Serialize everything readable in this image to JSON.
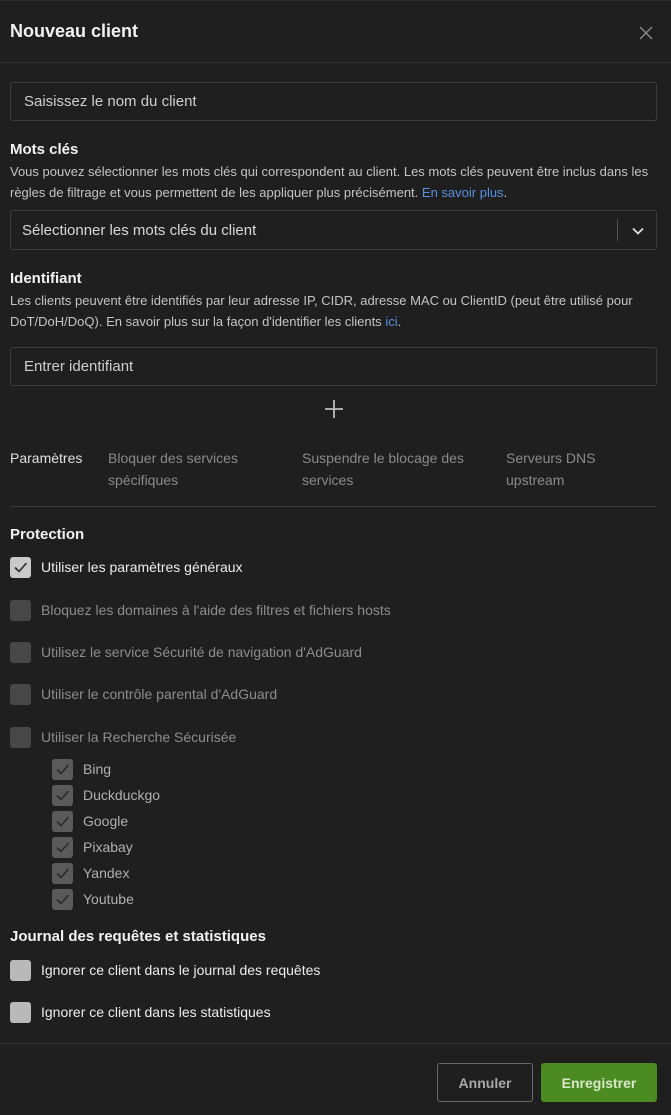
{
  "dialog": {
    "title": "Nouveau client",
    "close_icon": "close-icon"
  },
  "name_input": {
    "placeholder": "Saisissez le nom du client",
    "value": ""
  },
  "tags": {
    "title": "Mots clés",
    "description": "Vous pouvez sélectionner les mots clés qui correspondent au client. Les mots clés peuvent être inclus dans les règles de filtrage et vous permettent de les appliquer plus précisément.",
    "link_text": "En savoir plus",
    "link_suffix": ".",
    "select_placeholder": "Sélectionner les mots clés du client",
    "chevron_icon": "chevron-down-icon"
  },
  "identifier": {
    "title": "Identifiant",
    "description": "Les clients peuvent être identifiés par leur adresse IP, CIDR, adresse MAC ou ClientID (peut être utilisé pour DoT/DoH/DoQ). En savoir plus sur la façon d'identifier les clients",
    "link_text": "ici",
    "link_suffix": ".",
    "input_placeholder": "Entrer identifiant",
    "add_icon": "plus-icon"
  },
  "tabs": [
    {
      "label": "Paramètres",
      "active": true
    },
    {
      "label": "Bloquer des services spécifiques",
      "active": false
    },
    {
      "label": "Suspendre le blocage des services",
      "active": false
    },
    {
      "label": "Serveurs DNS upstream",
      "active": false
    }
  ],
  "protection": {
    "title": "Protection",
    "options": [
      {
        "label": "Utiliser les paramètres généraux",
        "checked": true
      },
      {
        "label": "Bloquez les domaines à l'aide des filtres et fichiers hosts",
        "checked": false
      },
      {
        "label": "Utilisez le service Sécurité de navigation d'AdGuard",
        "checked": false
      },
      {
        "label": "Utiliser le contrôle parental d'AdGuard",
        "checked": false
      },
      {
        "label": "Utiliser la Recherche Sécurisée",
        "checked": false
      }
    ],
    "safe_search_engines": [
      {
        "label": "Bing",
        "checked": true
      },
      {
        "label": "Duckduckgo",
        "checked": true
      },
      {
        "label": "Google",
        "checked": true
      },
      {
        "label": "Pixabay",
        "checked": true
      },
      {
        "label": "Yandex",
        "checked": true
      },
      {
        "label": "Youtube",
        "checked": true
      }
    ]
  },
  "logs": {
    "title": "Journal des requêtes et statistiques",
    "options": [
      {
        "label": "Ignorer ce client dans le journal des requêtes",
        "checked": false
      },
      {
        "label": "Ignorer ce client dans les statistiques",
        "checked": false
      }
    ]
  },
  "footer": {
    "cancel_label": "Annuler",
    "save_label": "Enregistrer"
  },
  "colors": {
    "background": "#1f1f1f",
    "accent_save": "#4c8a22",
    "link": "#5b8fe0"
  }
}
